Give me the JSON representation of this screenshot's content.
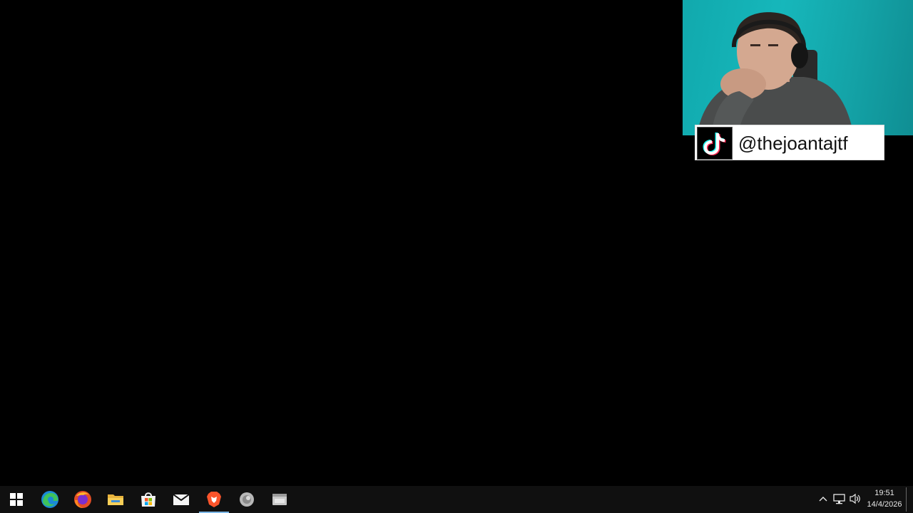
{
  "overlay": {
    "tiktok_handle": "@thejoantajtf",
    "tiktok_icon": "tiktok-logo-icon"
  },
  "taskbar": {
    "apps": [
      {
        "name": "Start",
        "icon": "windows-start-icon"
      },
      {
        "name": "Microsoft Edge",
        "icon": "edge-icon"
      },
      {
        "name": "Firefox",
        "icon": "firefox-icon"
      },
      {
        "name": "File Explorer",
        "icon": "folder-icon"
      },
      {
        "name": "Microsoft Store",
        "icon": "store-icon"
      },
      {
        "name": "Mail",
        "icon": "mail-icon"
      },
      {
        "name": "Brave",
        "icon": "brave-icon",
        "active": true
      },
      {
        "name": "App",
        "icon": "gray-app-icon"
      },
      {
        "name": "App",
        "icon": "gray-window-icon"
      }
    ],
    "tray": {
      "time": "19:51",
      "date": "14/4/2026",
      "icons": [
        "chevron-up-icon",
        "network-icon",
        "volume-icon"
      ]
    }
  },
  "colors": {
    "webcam_bg": "#14b0b4",
    "taskbar_bg": "#101010",
    "active_indicator": "#7cb7e6"
  }
}
